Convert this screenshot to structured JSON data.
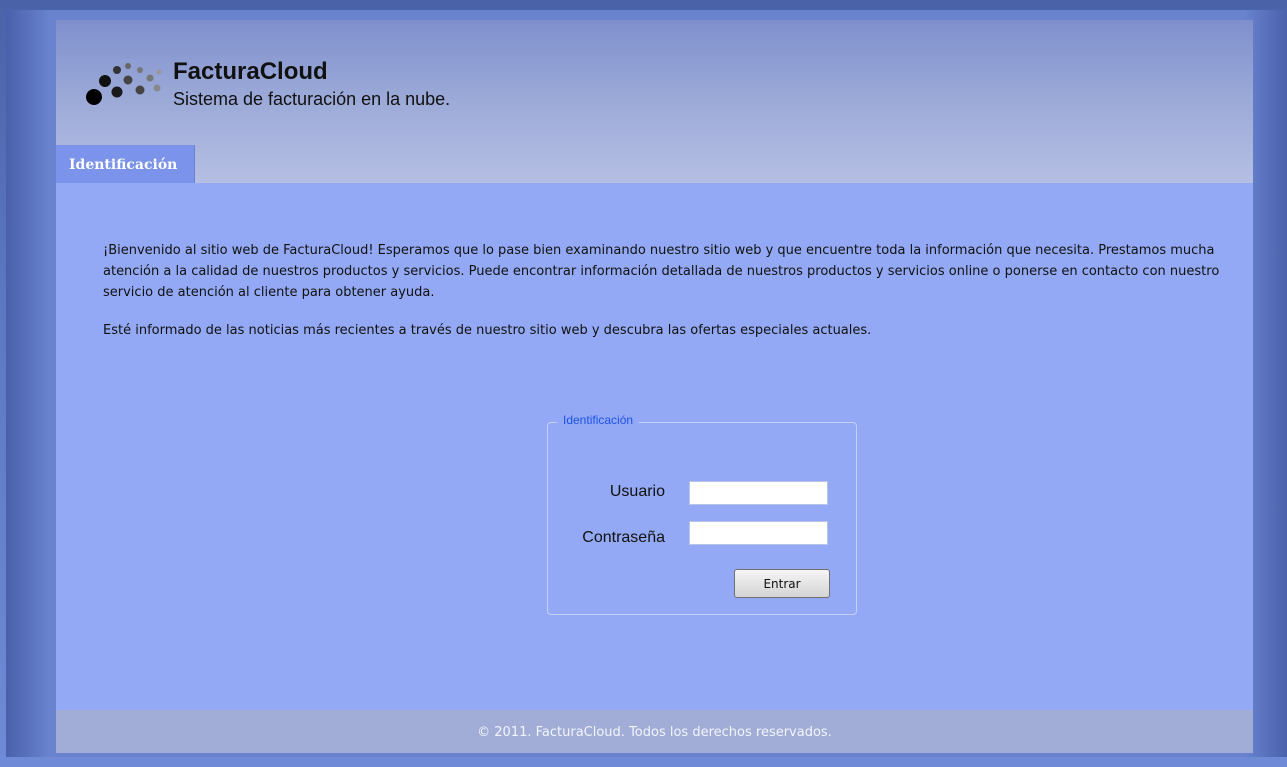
{
  "brand": {
    "name": "FacturaCloud",
    "tagline": "Sistema de facturación en la nube."
  },
  "nav": {
    "tabs": [
      {
        "label": "Identificación",
        "active": true
      }
    ]
  },
  "intro": {
    "paragraph1": "¡Bienvenido al sitio web de FacturaCloud! Esperamos que lo pase bien examinando nuestro sitio web y que encuentre toda la información que necesita. Prestamos mucha atención a la calidad de nuestros productos y servicios. Puede encontrar información detallada de nuestros productos y servicios online o ponerse en contacto con nuestro servicio de atención al cliente para obtener ayuda.",
    "paragraph2": "Esté informado de las noticias más recientes a través de nuestro sitio web y descubra las ofertas especiales actuales."
  },
  "login": {
    "legend": "Identificación",
    "username_label": "Usuario",
    "username_value": "",
    "password_label": "Contraseña",
    "password_value": "",
    "submit_label": "Entrar"
  },
  "footer": {
    "copyright": "© 2011. FacturaCloud. Todos los derechos reservados."
  },
  "colors": {
    "page_background": "#93a9f5",
    "outer_background": "#5d77c2",
    "tab_active": "#7b93ea",
    "legend_text": "#1d52e8",
    "footer_background": "#a1add6"
  },
  "icons": {
    "logo": "dots-logo-icon"
  }
}
